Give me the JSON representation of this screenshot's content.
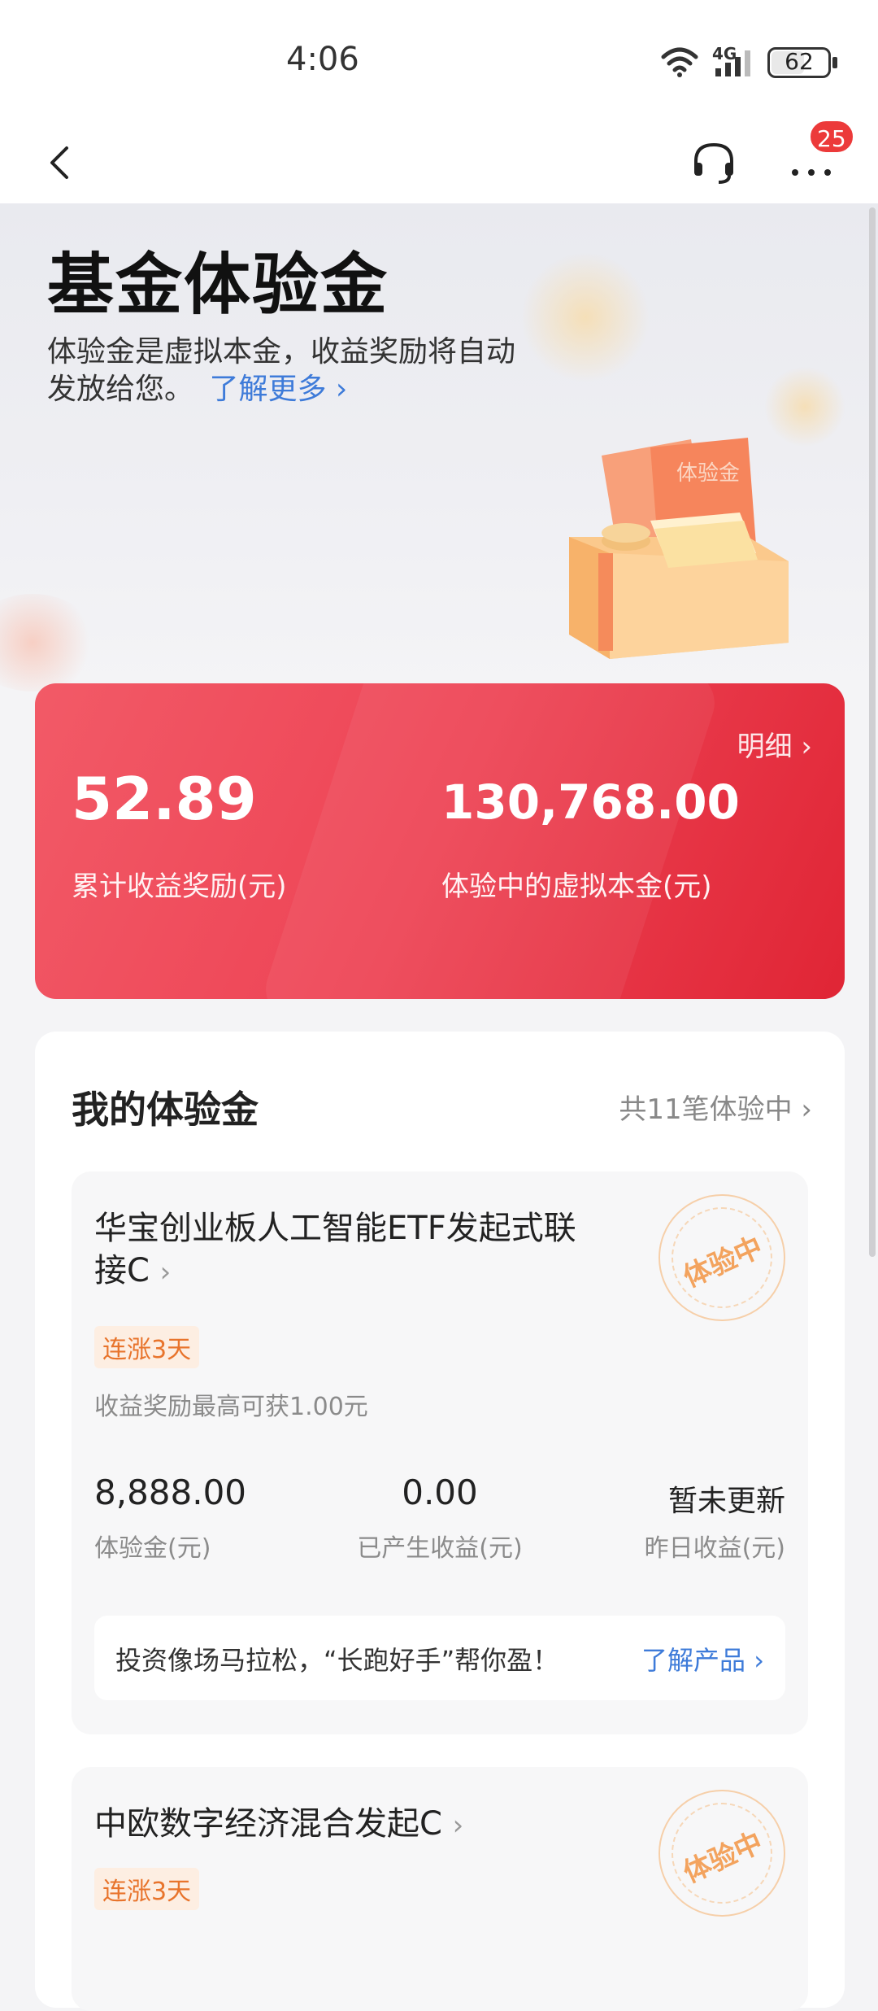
{
  "status_bar": {
    "time": "4:06",
    "network": "4G",
    "battery": "62",
    "battery_level_percent": 62
  },
  "nav": {
    "notification_count": "25",
    "icons": [
      "back-icon",
      "headset-icon",
      "more-icon"
    ]
  },
  "hero": {
    "title": "基金体验金",
    "description": "体验金是虚拟本金，收益奖励将自动发放给您。",
    "learn_more": "了解更多",
    "illustration_label": "体验金"
  },
  "summary": {
    "detail_link": "明细",
    "total_reward_value": "52.89",
    "total_reward_label": "累计收益奖励(元)",
    "principal_value": "130,768.00",
    "principal_label": "体验中的虚拟本金(元)"
  },
  "my_trial": {
    "title": "我的体验金",
    "count_label": "共11笔体验中",
    "funds": [
      {
        "name": "华宝创业板人工智能ETF发起式联接C",
        "stamp": "体验中",
        "tag": "连涨3天",
        "reward_note": "收益奖励最高可获1.00元",
        "trial_amount": "8,888.00",
        "trial_amount_label": "体验金(元)",
        "generated_income": "0.00",
        "generated_income_label": "已产生收益(元)",
        "yesterday_income": "暂未更新",
        "yesterday_income_label": "昨日收益(元)",
        "promo_text": "投资像场马拉松，“长跑好手”帮你盈！",
        "promo_link": "了解产品"
      },
      {
        "name": "中欧数字经济混合发起C",
        "stamp": "体验中",
        "tag": "连涨3天"
      }
    ]
  },
  "colors": {
    "accent_red": "#ee4657",
    "link_blue": "#3e7bd9",
    "tag_orange": "#e8742c"
  }
}
